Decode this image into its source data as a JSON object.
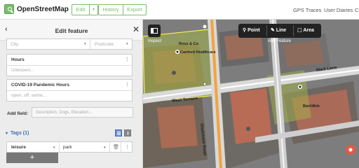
{
  "header": {
    "brand": "OpenStreetMap",
    "edit_label": "Edit",
    "edit_caret": "▾",
    "history_label": "History",
    "export_label": "Export",
    "links": [
      "GPS Traces",
      "User Diaries",
      "C"
    ]
  },
  "sidebar": {
    "title": "Edit feature",
    "back_icon": "‹",
    "close_icon": "✕",
    "address": {
      "city_placeholder": "City",
      "postcode_placeholder": "Postcode"
    },
    "hours": {
      "label": "Hours",
      "placeholder": "Unknown..."
    },
    "covid": {
      "label": "COVID-19 Pandemic Hours",
      "placeholder": "open, off, same..."
    },
    "more_icon": "⋮",
    "add_field": {
      "label": "Add field:",
      "placeholder": "Description, Dogs, Elevation..."
    },
    "tags": {
      "heading": "Tags (1)",
      "caret": "▾",
      "rows": [
        {
          "key": "leisure",
          "value": "park"
        }
      ],
      "add_label": "+"
    }
  },
  "map": {
    "inspect_label": "Inspect",
    "tools": [
      {
        "label": "Point"
      },
      {
        "label": "Line"
      },
      {
        "label": "Area"
      }
    ],
    "add_feature_label": "Add Feature",
    "pois": [
      "Ross & Co",
      "Canford Healthcare",
      "BarkWeb"
    ],
    "roads": [
      "West Terrace",
      "Gladstone Road",
      "Mark Lane"
    ]
  },
  "colors": {
    "brand_green": "#7ebc6f",
    "park_fill": "#b0c94a",
    "selection": "#f7f34a",
    "road_orange": "#f3a43c"
  }
}
